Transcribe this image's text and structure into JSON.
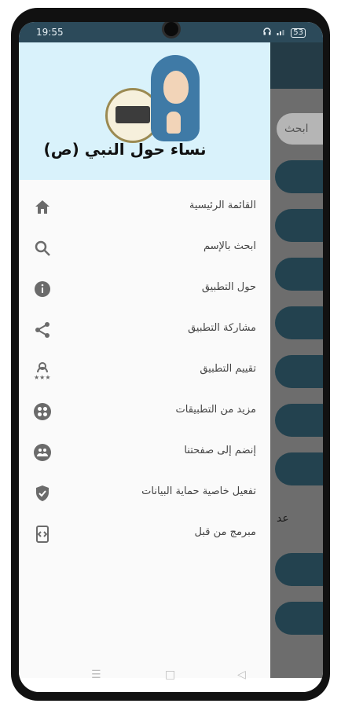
{
  "status_bar": {
    "time": "19:55",
    "battery": "53"
  },
  "drawer": {
    "title": "نساء حول النبي (ص)",
    "items": [
      {
        "label": "القائمة الرئيسية",
        "icon": "home-icon"
      },
      {
        "label": "ابحث بالإسم",
        "icon": "search-icon"
      },
      {
        "label": "حول التطبيق",
        "icon": "info-icon"
      },
      {
        "label": "مشاركة التطبيق",
        "icon": "share-icon"
      },
      {
        "label": "تقييم التطبيق",
        "icon": "rating-icon"
      },
      {
        "label": "مزيد من التطبيقات",
        "icon": "apps-icon"
      },
      {
        "label": "إنضم إلى صفحتنا",
        "icon": "community-icon"
      },
      {
        "label": "تفعيل خاصية حماية البيانات",
        "icon": "shield-icon"
      },
      {
        "label": "مبرمج من قبل",
        "icon": "developer-icon"
      }
    ]
  },
  "background_app": {
    "search_partial": "ابحث",
    "partial_text": "عد"
  },
  "colors": {
    "status_bar": "#2c4a5a",
    "header_bg": "#d9f2fb",
    "accent": "#23424f"
  }
}
